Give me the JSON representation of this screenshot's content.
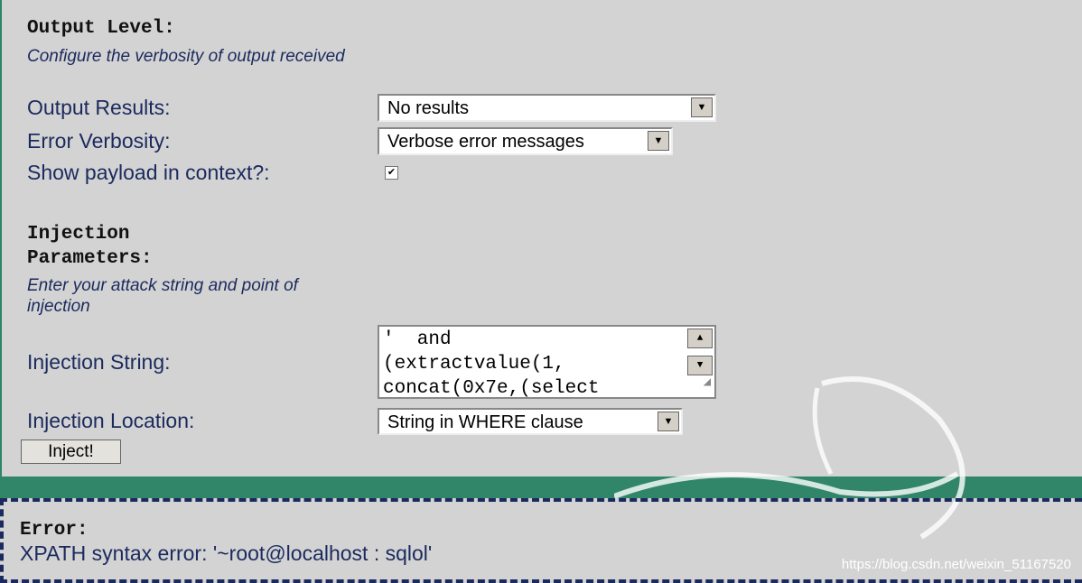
{
  "output": {
    "title": "Output Level:",
    "description": "Configure the verbosity of output received",
    "results_label": "Output Results:",
    "results_value": "No results",
    "verbosity_label": "Error Verbosity:",
    "verbosity_value": "Verbose error messages",
    "payload_label": "Show payload in context?:",
    "payload_checked": true
  },
  "injection": {
    "title": "Injection Parameters:",
    "description": "Enter your attack string and point of injection",
    "string_label": "Injection String:",
    "string_value": "'  and\n(extractvalue(1,\nconcat(0x7e,(select",
    "location_label": "Injection Location:",
    "location_value": "String in WHERE clause",
    "inject_button": "Inject!"
  },
  "error": {
    "title": "Error:",
    "message": "XPATH syntax error: '~root@localhost : sqlol'"
  },
  "watermark": "https://blog.csdn.net/weixin_51167520",
  "colors": {
    "band": "#31866a",
    "text": "#1b2a5e"
  }
}
